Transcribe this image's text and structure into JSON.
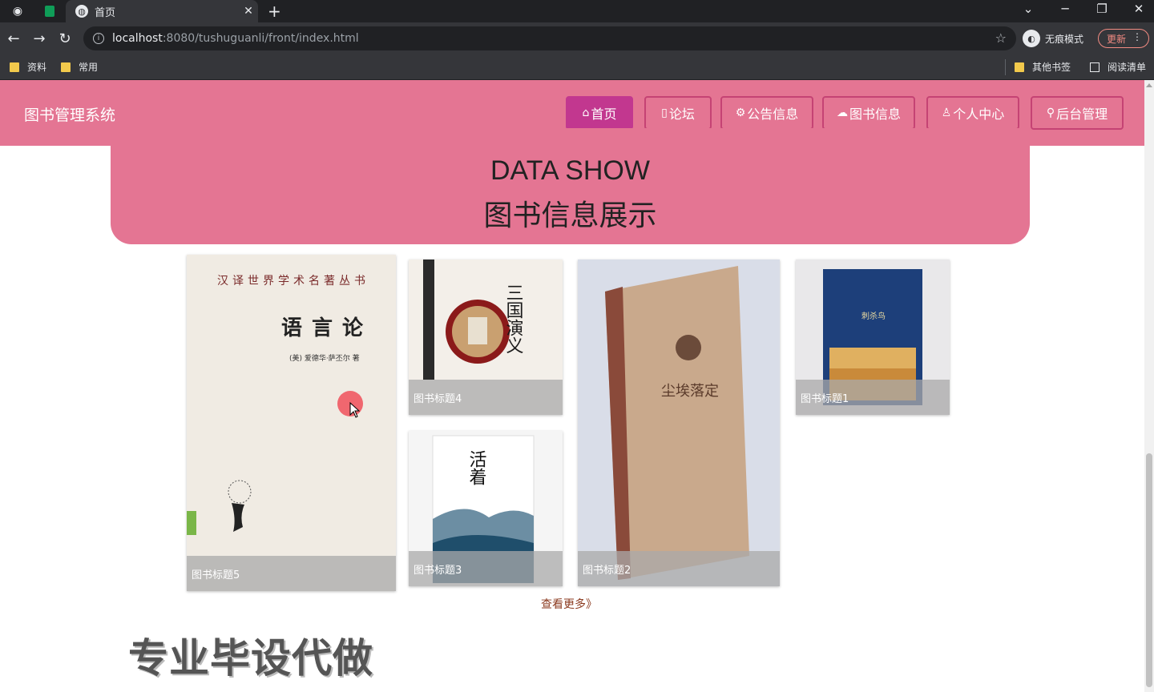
{
  "browser": {
    "tab_title": "首页",
    "url_host": "localhost",
    "url_path": ":8080/tushuguanli/front/index.html",
    "incognito_label": "无痕模式",
    "update_label": "更新",
    "bookmarks": [
      "资料",
      "常用"
    ],
    "other_bookmarks": "其他书签",
    "reading_list": "阅读清单"
  },
  "header": {
    "logo": "图书管理系统",
    "nav": [
      {
        "label": "首页",
        "icon": "home-icon",
        "active": true
      },
      {
        "label": "论坛",
        "icon": "forum-icon",
        "active": false
      },
      {
        "label": "公告信息",
        "icon": "notice-icon",
        "active": false
      },
      {
        "label": "图书信息",
        "icon": "cloud-icon",
        "active": false
      },
      {
        "label": "个人中心",
        "icon": "user-icon",
        "active": false
      },
      {
        "label": "后台管理",
        "icon": "link-icon",
        "active": false
      }
    ]
  },
  "banner": {
    "title_en": "DATA SHOW",
    "title_cn": "图书信息展示"
  },
  "books": [
    {
      "caption": "图书标题5",
      "cover_text": "语言论"
    },
    {
      "caption": "图书标题4",
      "cover_text": "三国演义"
    },
    {
      "caption": "图书标题3",
      "cover_text": "活着"
    },
    {
      "caption": "图书标题2",
      "cover_text": "尘埃落定"
    },
    {
      "caption": "图书标题1",
      "cover_text": "刺杀鸟"
    }
  ],
  "more_link": "查看更多》",
  "watermark": "专业毕设代做",
  "colors": {
    "header_bg": "#e47593",
    "nav_active": "#c2378f",
    "nav_border": "#c54374",
    "more_link": "#8b3a1f"
  }
}
